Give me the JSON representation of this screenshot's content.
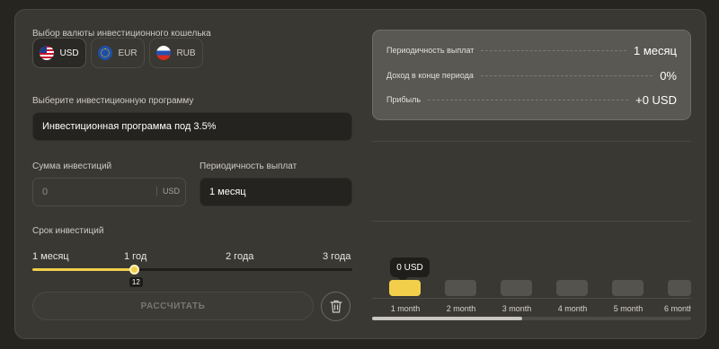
{
  "currency": {
    "label": "Выбор валюты инвестиционного кошелька",
    "options": [
      {
        "code": "USD",
        "icon": "us-flag-icon",
        "selected": true
      },
      {
        "code": "EUR",
        "icon": "eu-flag-icon",
        "selected": false
      },
      {
        "code": "RUB",
        "icon": "ru-flag-icon",
        "selected": false
      }
    ]
  },
  "program": {
    "label": "Выберите инвестиционную программу",
    "value": "Инвестиционная программа под 3.5%"
  },
  "amount": {
    "label": "Сумма инвестиций",
    "placeholder": "0",
    "suffix": "USD"
  },
  "payout": {
    "label": "Периодичность выплат",
    "value": "1 месяц"
  },
  "term": {
    "label": "Срок инвестиций",
    "ticks": [
      "1 месяц",
      "1 год",
      "2 года",
      "3 года"
    ],
    "value": "12",
    "fraction": 0.32
  },
  "actions": {
    "calculate": "РАССЧИТАТЬ",
    "reset_icon": "trash-icon"
  },
  "summary": {
    "rows": [
      {
        "key": "Периодичность выплат",
        "value": "1 месяц"
      },
      {
        "key": "Доход в конце периода",
        "value": "0%"
      },
      {
        "key": "Прибыль",
        "value": "+0 USD"
      }
    ]
  },
  "timeline": {
    "tooltip": "0 USD",
    "months": [
      "1 month",
      "2 month",
      "3 month",
      "4 month",
      "5 month",
      "6 month"
    ],
    "active_index": 0,
    "scroll_fraction": 0.47
  },
  "colors": {
    "accent": "#f2cf4b",
    "panel": "#393833",
    "background": "#262520"
  }
}
